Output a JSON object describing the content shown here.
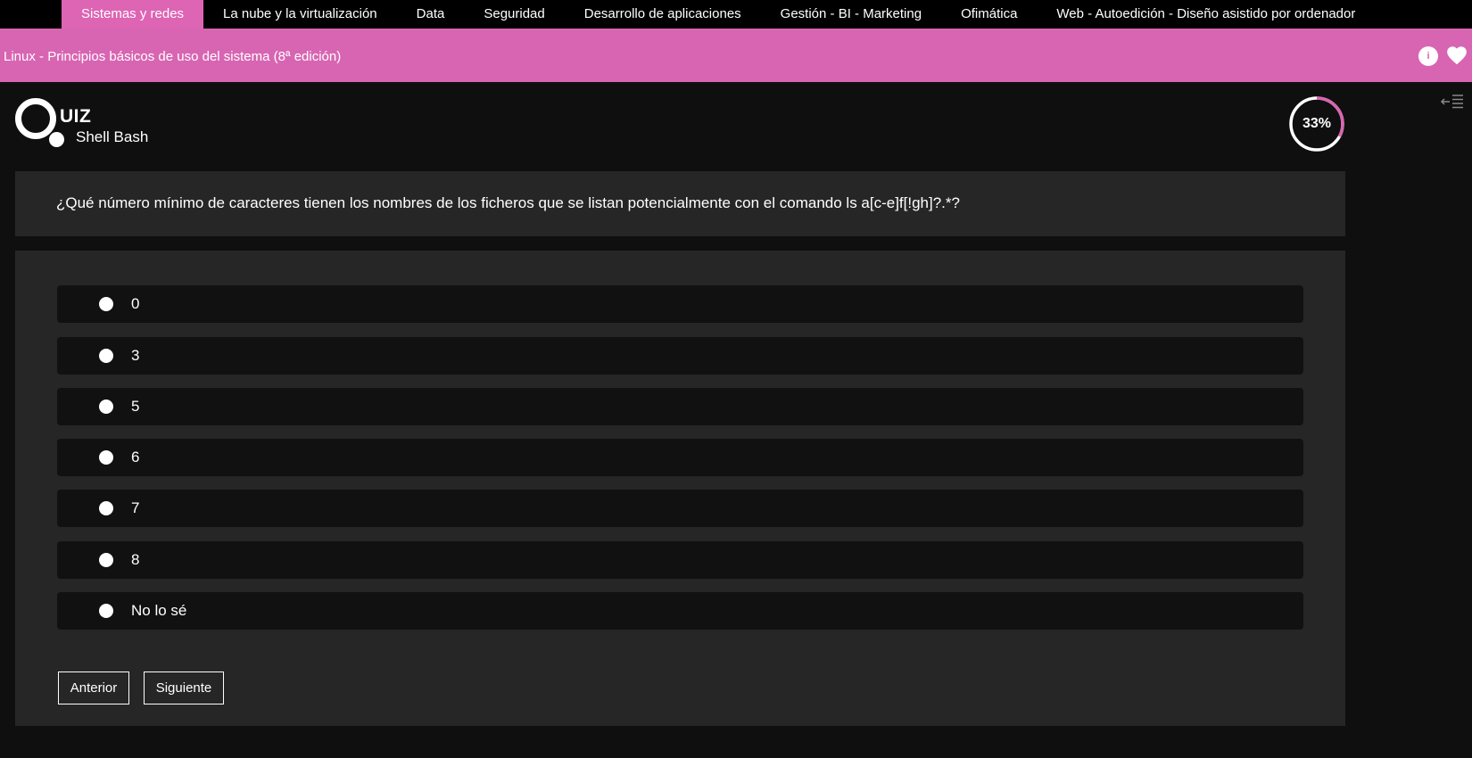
{
  "topnav": {
    "items": [
      {
        "label": "Sistemas y redes",
        "active": true
      },
      {
        "label": "La nube y la virtualización"
      },
      {
        "label": "Data"
      },
      {
        "label": "Seguridad"
      },
      {
        "label": "Desarrollo de aplicaciones"
      },
      {
        "label": "Gestión - BI - Marketing"
      },
      {
        "label": "Ofimática"
      },
      {
        "label": "Web - Autoedición - Diseño asistido por ordenador"
      }
    ]
  },
  "book": {
    "title": "Linux - Principios básicos de uso del sistema (8ª edición)",
    "info_icon": "info-icon",
    "heart_icon": "heart-icon"
  },
  "quiz": {
    "logo_text": "UIZ",
    "subtitle": "Shell Bash",
    "progress_label": "33%",
    "progress_value": 0.33,
    "question": "¿Qué número mínimo de caracteres tienen los nombres de los ficheros que se listan potencialmente con el comando ls a[c-e]f[!gh]?.*?",
    "answers": [
      "0",
      "3",
      "5",
      "6",
      "7",
      "8",
      "No lo sé"
    ],
    "prev_label": "Anterior",
    "next_label": "Siguiente"
  },
  "colors": {
    "accent": "#d865b2",
    "nav_active": "#de64b4",
    "background": "#0f0f0f",
    "panel": "#262626"
  }
}
